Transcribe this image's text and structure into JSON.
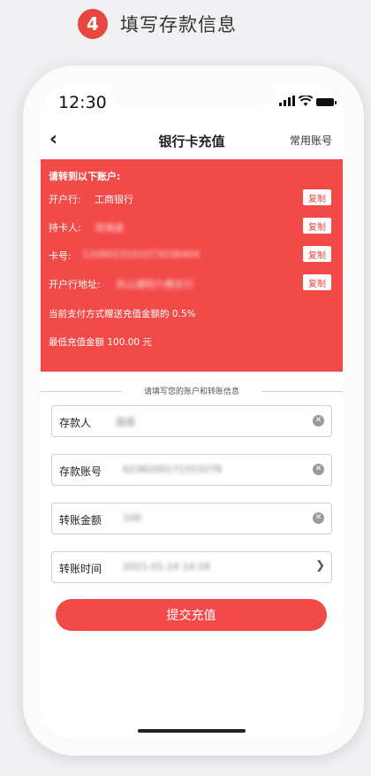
{
  "step": {
    "number": "4",
    "title": "填写存款信息"
  },
  "status_bar": {
    "time": "12:30"
  },
  "nav": {
    "back": "‹",
    "title": "银行卡充值",
    "right": "常用账号"
  },
  "account_panel": {
    "heading": "请转到以下账户:",
    "rows": [
      {
        "label": "开户行:",
        "value": "工商银行",
        "copy": "复制"
      },
      {
        "label": "持卡人:",
        "value": "流海波",
        "copy": "复制"
      },
      {
        "label": "卡号:",
        "value": "1208023101073038404",
        "copy": "复制"
      },
      {
        "label": "开户行地址:",
        "value": "舟山潮阳六横支行",
        "copy": "复制"
      }
    ],
    "note1": "当前支付方式赠送充值金额的 0.5%",
    "note2": "最低充值金额 100.00 元"
  },
  "divider_text": "请填写您的账户和转账信息",
  "form": {
    "fields": [
      {
        "label": "存款人",
        "value": "周周"
      },
      {
        "label": "存款账号",
        "value": "6236200171553278"
      },
      {
        "label": "转账金额",
        "value": "100"
      },
      {
        "label": "转账时间",
        "value": "2021-01-14 14:16"
      }
    ]
  },
  "submit_label": "提交充值",
  "colors": {
    "accent": "#f24a48",
    "badge": "#e8463f"
  },
  "icons": [
    "back-icon",
    "signal-icon",
    "wifi-icon",
    "battery-icon",
    "clear-icon",
    "picker-icon"
  ]
}
